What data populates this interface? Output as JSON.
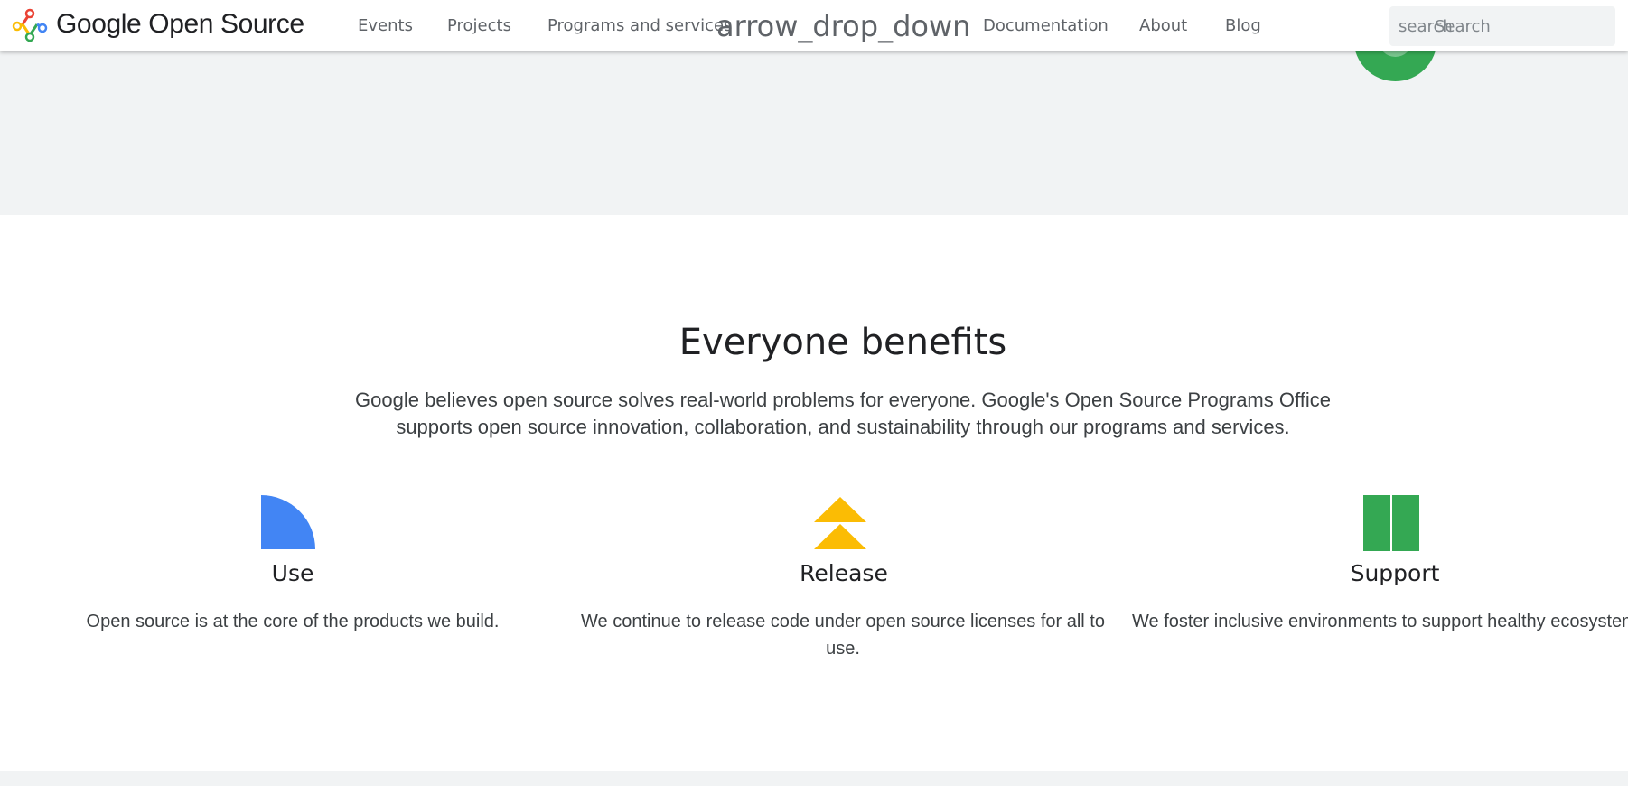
{
  "header": {
    "brand": "Google Open Source",
    "nav": [
      {
        "label": "Events"
      },
      {
        "label": "Projects"
      },
      {
        "label": "Programs and services"
      },
      {
        "label": "Documentation"
      },
      {
        "label": "About"
      },
      {
        "label": "Blog"
      }
    ],
    "dropdown_icon_text": "arrow_drop_down",
    "search": {
      "icon_text": "search",
      "placeholder": "Search"
    }
  },
  "hero": {
    "circle_color": "#34a853"
  },
  "benefits": {
    "title": "Everyone benefits",
    "description": "Google believes open source solves real-world problems for everyone. Google's Open Source Programs Office supports open source innovation, collaboration, and sustainability through our programs and services.",
    "items": [
      {
        "icon": "quarter-circle-icon",
        "color": "#4285f4",
        "title": "Use",
        "description": "Open source is at the core of the products we build."
      },
      {
        "icon": "double-chevron-up-icon",
        "color": "#fbbc04",
        "title": "Release",
        "description": "We continue to release code under open source licenses for all to use."
      },
      {
        "icon": "bowtie-icon",
        "color": "#34a853",
        "title": "Support",
        "description": "We foster inclusive environments to support healthy ecosystems."
      }
    ]
  },
  "colors": {
    "accent_blue": "#4285f4",
    "accent_yellow": "#fbbc04",
    "accent_green": "#34a853",
    "accent_red": "#ea4335",
    "band_grey": "#f1f3f4"
  }
}
